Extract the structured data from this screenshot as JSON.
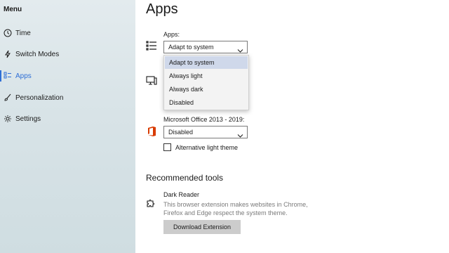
{
  "sidebar": {
    "menu_title": "Menu",
    "items": [
      {
        "label": "Time",
        "icon": "clock-icon"
      },
      {
        "label": "Switch Modes",
        "icon": "lightning-icon"
      },
      {
        "label": "Apps",
        "icon": "apps-icon"
      },
      {
        "label": "Personalization",
        "icon": "brush-icon"
      },
      {
        "label": "Settings",
        "icon": "gear-icon"
      }
    ],
    "active": "Apps",
    "accent": "#2f6fd6"
  },
  "main": {
    "title": "Apps",
    "apps_label": "Apps:",
    "apps_value": "Adapt to system",
    "apps_options": [
      "Adapt to system",
      "Always light",
      "Always dark",
      "Disabled"
    ],
    "office_label": "Microsoft Office 2013 - 2019:",
    "office_value": "Disabled",
    "alt_theme_label": "Alternative light theme",
    "recommended_title": "Recommended tools",
    "tool_name": "Dark Reader",
    "tool_desc": "This browser extension makes websites in Chrome, Firefox and Edge respect the system theme.",
    "download_label": "Download Extension"
  }
}
